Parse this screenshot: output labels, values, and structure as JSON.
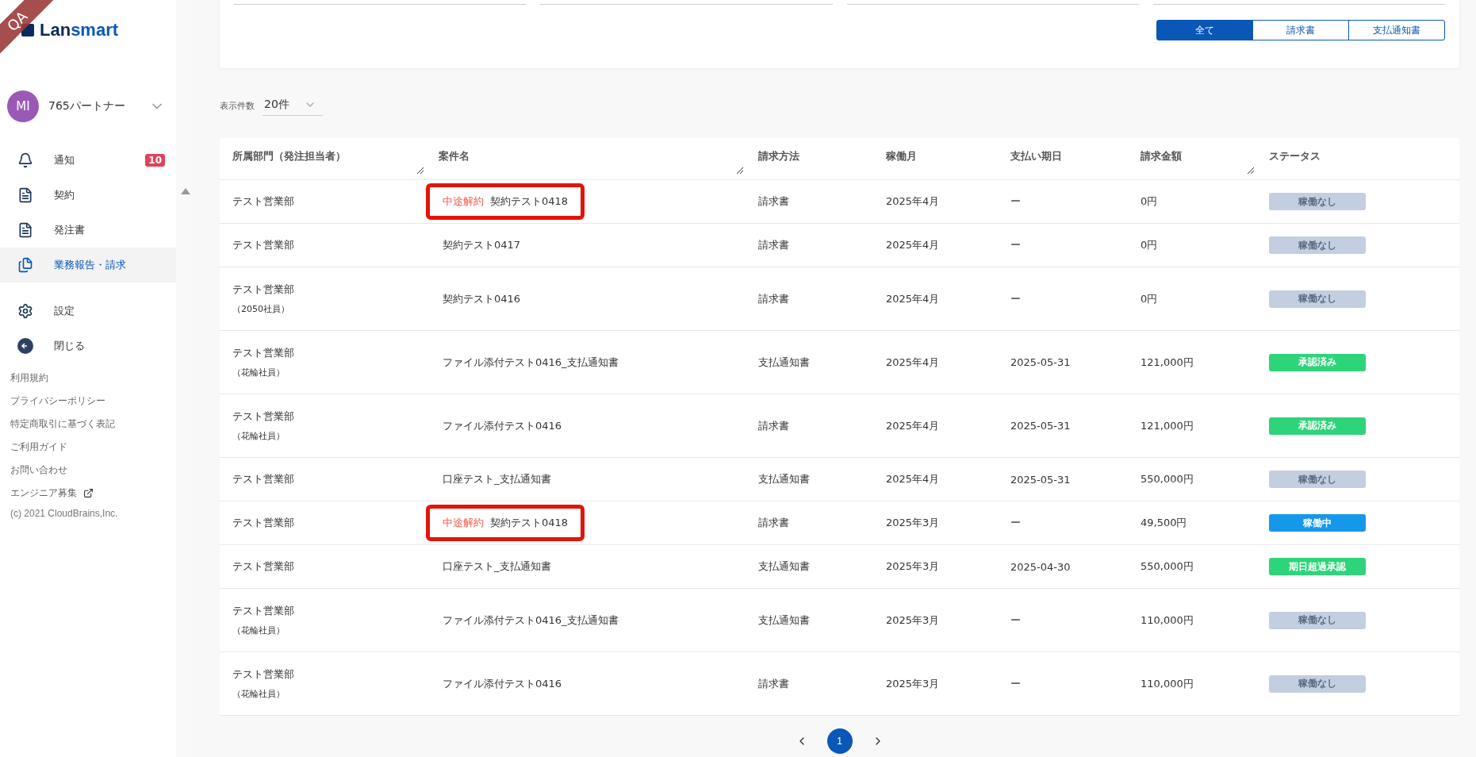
{
  "env_ribbon": "QA",
  "logo": {
    "text_dark": "Lan",
    "text_blue": "smart"
  },
  "account": {
    "initials": "MI",
    "name": "765パートナー"
  },
  "nav": [
    {
      "label": "通知",
      "badge": "10",
      "selected": false
    },
    {
      "label": "契約",
      "selected": false
    },
    {
      "label": "発注書",
      "selected": false
    },
    {
      "label": "業務報告・請求",
      "selected": true
    },
    {
      "label": "設定",
      "selected": false
    },
    {
      "label": "閉じる",
      "selected": false
    }
  ],
  "footer_links": [
    {
      "label": "利用規約",
      "external": false
    },
    {
      "label": "プライバシーポリシー",
      "external": false
    },
    {
      "label": "特定商取引に基づく表記",
      "external": false
    },
    {
      "label": "ご利用ガイド",
      "external": false
    },
    {
      "label": "お問い合わせ",
      "external": false
    },
    {
      "label": "エンジニア募集",
      "external": true
    }
  ],
  "copyright": "(c) 2021 CloudBrains,Inc.",
  "filter_tabs": [
    {
      "label": "全て",
      "selected": true
    },
    {
      "label": "請求書",
      "selected": false
    },
    {
      "label": "支払通知書",
      "selected": false
    }
  ],
  "page_size": {
    "label": "表示件数",
    "value": "20件"
  },
  "table": {
    "columns": [
      {
        "label": "所属部門（発注担当者）",
        "resizable": true
      },
      {
        "label": "案件名",
        "resizable": true
      },
      {
        "label": "請求方法",
        "resizable": false
      },
      {
        "label": "稼働月",
        "resizable": false
      },
      {
        "label": "支払い期日",
        "resizable": false
      },
      {
        "label": "請求金額",
        "resizable": true
      },
      {
        "label": "ステータス",
        "resizable": false
      }
    ],
    "rows": [
      {
        "dept": "テスト営業部",
        "tag": "中途解約",
        "project": "契約テスト0418",
        "method": "請求書",
        "month": "2025年4月",
        "due": "ー",
        "amount": "0円",
        "status": {
          "label": "稼働なし",
          "color": "#c3cfe0"
        },
        "annotated": true
      },
      {
        "dept": "テスト営業部",
        "project": "契約テスト0417",
        "method": "請求書",
        "month": "2025年4月",
        "due": "ー",
        "amount": "0円",
        "status": {
          "label": "稼働なし",
          "color": "#c3cfe0"
        },
        "annotated": false
      },
      {
        "dept": "テスト営業部",
        "member": "（2050社員）",
        "project": "契約テスト0416",
        "method": "請求書",
        "month": "2025年4月",
        "due": "ー",
        "amount": "0円",
        "status": {
          "label": "稼働なし",
          "color": "#c3cfe0"
        },
        "annotated": false
      },
      {
        "dept": "テスト営業部",
        "member": "（花輪社員）",
        "project": "ファイル添付テスト0416_支払通知書",
        "method": "支払通知書",
        "month": "2025年4月",
        "due": "2025-05-31",
        "amount": "121,000円",
        "status": {
          "label": "承認済み",
          "color": "#2ed47a"
        },
        "annotated": false
      },
      {
        "dept": "テスト営業部",
        "member": "（花輪社員）",
        "project": "ファイル添付テスト0416",
        "method": "請求書",
        "month": "2025年4月",
        "due": "2025-05-31",
        "amount": "121,000円",
        "status": {
          "label": "承認済み",
          "color": "#2ed47a"
        },
        "annotated": false
      },
      {
        "dept": "テスト営業部",
        "project": "口座テスト_支払通知書",
        "method": "支払通知書",
        "month": "2025年4月",
        "due": "2025-05-31",
        "amount": "550,000円",
        "status": {
          "label": "稼働なし",
          "color": "#c3cfe0"
        },
        "annotated": false
      },
      {
        "dept": "テスト営業部",
        "tag": "中途解約",
        "project": "契約テスト0418",
        "method": "請求書",
        "month": "2025年3月",
        "due": "ー",
        "amount": "49,500円",
        "status": {
          "label": "稼働中",
          "color": "#1698ea"
        },
        "annotated": true
      },
      {
        "dept": "テスト営業部",
        "project": "口座テスト_支払通知書",
        "method": "支払通知書",
        "month": "2025年3月",
        "due": "2025-04-30",
        "amount": "550,000円",
        "status": {
          "label": "期日超過承認",
          "color": "#2ed47a"
        },
        "annotated": false
      },
      {
        "dept": "テスト営業部",
        "member": "（花輪社員）",
        "project": "ファイル添付テスト0416_支払通知書",
        "method": "支払通知書",
        "month": "2025年3月",
        "due": "ー",
        "amount": "110,000円",
        "status": {
          "label": "稼働なし",
          "color": "#c3cfe0"
        },
        "annotated": false
      },
      {
        "dept": "テスト営業部",
        "member": "（花輪社員）",
        "project": "ファイル添付テスト0416",
        "method": "請求書",
        "month": "2025年3月",
        "due": "ー",
        "amount": "110,000円",
        "status": {
          "label": "稼働なし",
          "color": "#c3cfe0"
        },
        "annotated": false
      }
    ]
  },
  "pagination": {
    "pages": [
      {
        "label": "1",
        "selected": true
      }
    ]
  }
}
